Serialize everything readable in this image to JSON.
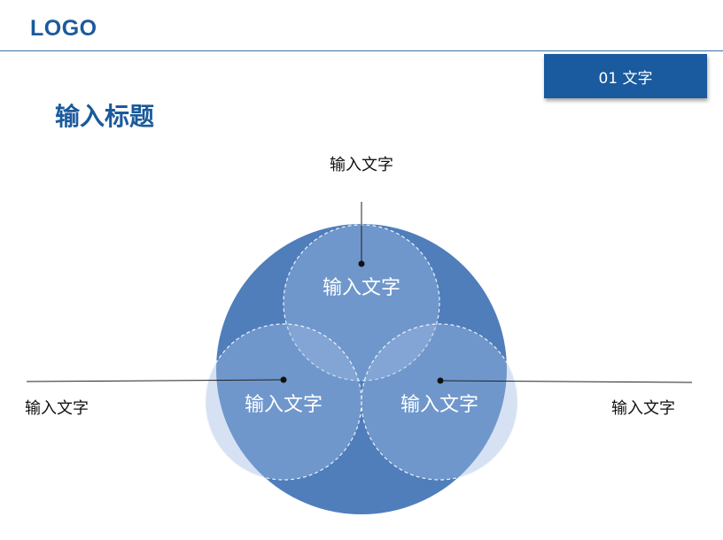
{
  "header": {
    "logo": "LOGO",
    "section_tag": "01 文字"
  },
  "page": {
    "title": "输入标题"
  },
  "diagram": {
    "outer_circle_label": "",
    "circles": [
      {
        "id": "top",
        "label": "输入文字"
      },
      {
        "id": "left",
        "label": "输入文字"
      },
      {
        "id": "right",
        "label": "输入文字"
      }
    ],
    "callouts": {
      "top": "输入文字",
      "left": "输入文字",
      "right": "输入文字"
    },
    "colors": {
      "outer": "#4f7ebb",
      "inner": "#7ea1d0",
      "dash": "#eef3fa"
    }
  }
}
